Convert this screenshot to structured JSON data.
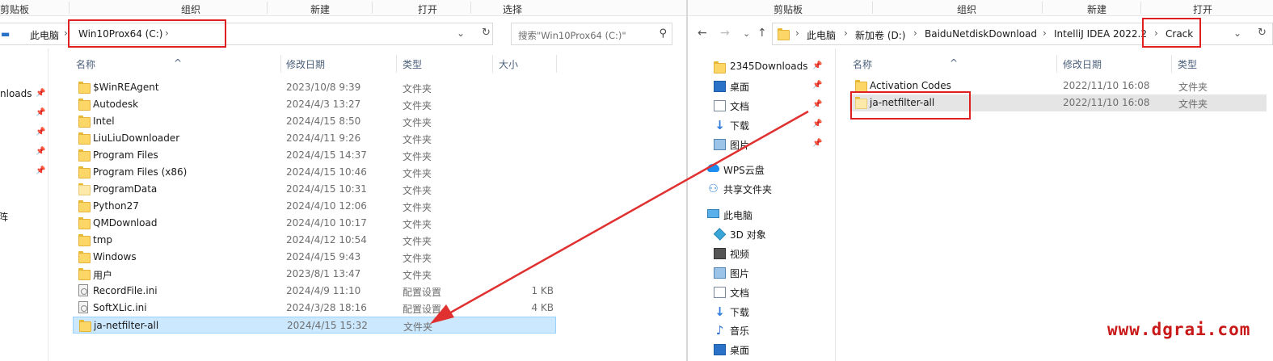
{
  "left": {
    "ribbon": [
      "剪贴板",
      "组织",
      "新建",
      "打开",
      "选择"
    ],
    "breadcrumb": [
      "此电脑",
      "Win10Prox64 (C:)"
    ],
    "search_placeholder": "搜索\"Win10Prox64 (C:)\"",
    "nav_partial": "nloads",
    "nav_partial2": "阵",
    "columns": [
      "名称",
      "修改日期",
      "类型",
      "大小"
    ],
    "rows": [
      {
        "name": "$WinREAgent",
        "date": "2023/10/8 9:39",
        "type": "文件夹",
        "size": "",
        "icon": "folder"
      },
      {
        "name": "Autodesk",
        "date": "2024/4/3 13:27",
        "type": "文件夹",
        "size": "",
        "icon": "folder"
      },
      {
        "name": "Intel",
        "date": "2024/4/15 8:50",
        "type": "文件夹",
        "size": "",
        "icon": "folder"
      },
      {
        "name": "LiuLiuDownloader",
        "date": "2024/4/11 9:26",
        "type": "文件夹",
        "size": "",
        "icon": "folder"
      },
      {
        "name": "Program Files",
        "date": "2024/4/15 14:37",
        "type": "文件夹",
        "size": "",
        "icon": "folder"
      },
      {
        "name": "Program Files (x86)",
        "date": "2024/4/15 10:46",
        "type": "文件夹",
        "size": "",
        "icon": "folder"
      },
      {
        "name": "ProgramData",
        "date": "2024/4/15 10:31",
        "type": "文件夹",
        "size": "",
        "icon": "folder-pale"
      },
      {
        "name": "Python27",
        "date": "2024/4/10 12:06",
        "type": "文件夹",
        "size": "",
        "icon": "folder"
      },
      {
        "name": "QMDownload",
        "date": "2024/4/10 10:17",
        "type": "文件夹",
        "size": "",
        "icon": "folder"
      },
      {
        "name": "tmp",
        "date": "2024/4/12 10:54",
        "type": "文件夹",
        "size": "",
        "icon": "folder"
      },
      {
        "name": "Windows",
        "date": "2024/4/15 9:43",
        "type": "文件夹",
        "size": "",
        "icon": "folder"
      },
      {
        "name": "用户",
        "date": "2023/8/1 13:47",
        "type": "文件夹",
        "size": "",
        "icon": "folder"
      },
      {
        "name": "RecordFile.ini",
        "date": "2024/4/9 11:10",
        "type": "配置设置",
        "size": "1 KB",
        "icon": "file"
      },
      {
        "name": "SoftXLic.ini",
        "date": "2024/3/28 18:16",
        "type": "配置设置",
        "size": "4 KB",
        "icon": "file"
      },
      {
        "name": "ja-netfilter-all",
        "date": "2024/4/15 15:32",
        "type": "文件夹",
        "size": "",
        "icon": "folder",
        "selected": true
      }
    ]
  },
  "right": {
    "ribbon": [
      "剪贴板",
      "组织",
      "新建",
      "打开"
    ],
    "breadcrumb": [
      "此电脑",
      "新加卷 (D:)",
      "BaiduNetdiskDownload",
      "IntelliJ IDEA 2022.2",
      "Crack"
    ],
    "columns": [
      "名称",
      "修改日期",
      "类型"
    ],
    "nav": [
      {
        "label": "2345Downloads",
        "icon": "folder-icon",
        "pinned": true
      },
      {
        "label": "桌面",
        "icon": "desktop-icon",
        "pinned": true
      },
      {
        "label": "文档",
        "icon": "document-icon",
        "pinned": true
      },
      {
        "label": "下载",
        "icon": "download-icon",
        "pinned": true
      },
      {
        "label": "图片",
        "icon": "picture-icon",
        "pinned": true
      },
      {
        "label": "WPS云盘",
        "icon": "cloud-icon",
        "pinned": false
      },
      {
        "label": "共享文件夹",
        "icon": "share-icon",
        "pinned": false
      },
      {
        "label": "此电脑",
        "icon": "computer-icon",
        "pinned": false
      },
      {
        "label": "3D 对象",
        "icon": "cube-icon",
        "pinned": false
      },
      {
        "label": "视频",
        "icon": "video-icon",
        "pinned": false
      },
      {
        "label": "图片",
        "icon": "picture-icon",
        "pinned": false
      },
      {
        "label": "文档",
        "icon": "document-icon",
        "pinned": false
      },
      {
        "label": "下载",
        "icon": "download-icon",
        "pinned": false
      },
      {
        "label": "音乐",
        "icon": "music-icon",
        "pinned": false
      },
      {
        "label": "桌面",
        "icon": "desktop-icon",
        "pinned": false
      }
    ],
    "rows": [
      {
        "name": "Activation Codes",
        "date": "2022/11/10 16:08",
        "type": "文件夹"
      },
      {
        "name": "ja-netfilter-all",
        "date": "2022/11/10 16:08",
        "type": "文件夹"
      }
    ]
  },
  "watermark": "www.dgrai.com",
  "colors": {
    "highlight_box": "#e02020",
    "selected_row": "#cce8ff",
    "hover_row": "#e5e5e5",
    "arrow": "#e03030"
  }
}
